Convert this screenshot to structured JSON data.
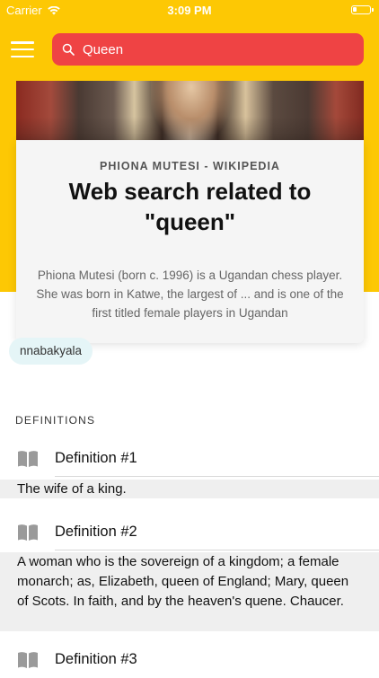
{
  "status_bar": {
    "carrier": "Carrier",
    "time": "3:09 PM",
    "wifi_icon": "wifi-icon",
    "battery_icon": "battery-icon"
  },
  "nav": {
    "menu_icon": "hamburger-menu-icon"
  },
  "search": {
    "value": "Queen",
    "icon": "search-icon"
  },
  "card": {
    "source": "PHIONA MUTESI - WIKIPEDIA",
    "title": "Web search related to \"queen\"",
    "snippet": "Phiona Mutesi (born c. 1996) is a Ugandan chess player. She was born in Katwe, the largest of ... and is one of the first titled female players in Ugandan"
  },
  "tag": {
    "label": "nnabakyala"
  },
  "definitions": {
    "header": "DEFINITIONS",
    "items": [
      {
        "title": "Definition #1",
        "text": "The wife of a king.",
        "icon": "book-icon"
      },
      {
        "title": "Definition #2",
        "text": "A woman who is the sovereign of a kingdom; a female monarch; as, Elizabeth, queen of England; Mary, queen of Scots. In faith, and by the heaven's quene. Chaucer.",
        "icon": "book-icon"
      },
      {
        "title": "Definition #3",
        "text": "",
        "icon": "book-icon"
      }
    ]
  },
  "colors": {
    "header_yellow": "#fdc804",
    "search_red": "#ef4344",
    "tag_bg": "#e5f5f7"
  }
}
